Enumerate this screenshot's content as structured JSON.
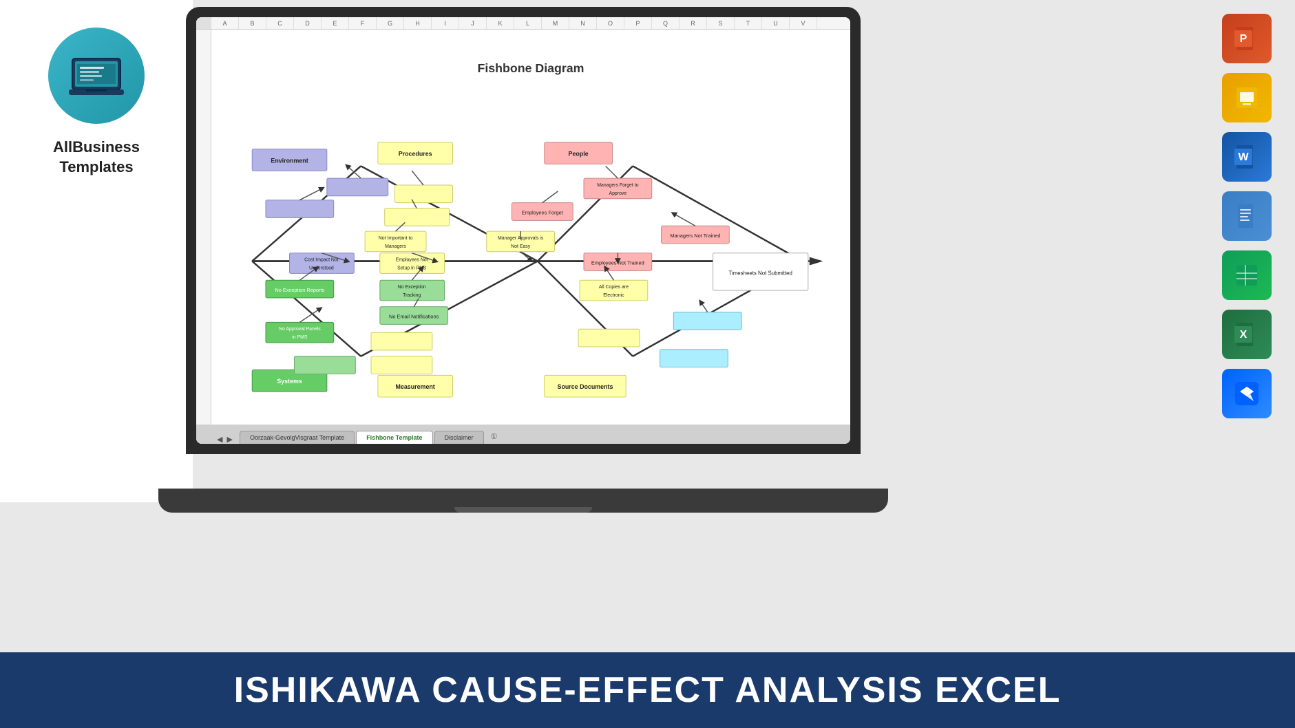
{
  "brand": {
    "name": "AllBusiness\nTemplates",
    "circle_color": "#3bb5c8"
  },
  "diagram": {
    "title": "Fishbone Diagram",
    "categories": {
      "environment": "Environment",
      "procedures": "Procedures",
      "people": "People",
      "systems": "Systems",
      "measurement": "Measurement",
      "source_documents": "Source Documents"
    },
    "boxes": {
      "managers_forget": "Managers Forget to\nApprove",
      "employees_forget": "Employees Forget",
      "managers_not_trained": "Managers Not Trained",
      "manager_approvals": "Manager Approvals is\nNot Easy",
      "employees_not_trained": "Employees Not Trained",
      "not_important": "Not Important to\nManagers",
      "cost_impact": "Cost Impact Not\nUnderstood",
      "employees_not_setup": "Employees Not\nSetup in PMS",
      "no_exception_reports": "No Exception Reports",
      "no_exception_tracking": "No Exception\nTracking",
      "all_copies": "All Copies are\nElectronic",
      "no_email": "No Email Notifications",
      "no_approval_panels": "No Approval Panels\nin PMS",
      "timesheets": "Timesheets Not Submitted"
    }
  },
  "tabs": {
    "tab1": "Oorzaak-GevolgVisgraat Template",
    "tab2": "Fishbone Template",
    "tab3": "Disclaimer"
  },
  "apps": [
    {
      "name": "powerpoint-icon",
      "label": "PowerPoint",
      "color": "#c43e1c"
    },
    {
      "name": "slides-icon",
      "label": "Google Slides",
      "color": "#e8a000"
    },
    {
      "name": "word-icon",
      "label": "Word",
      "color": "#1254a1"
    },
    {
      "name": "docs-icon",
      "label": "Google Docs",
      "color": "#3a7dc4"
    },
    {
      "name": "sheets-icon",
      "label": "Google Sheets",
      "color": "#0f9d58"
    },
    {
      "name": "excel-icon",
      "label": "Excel",
      "color": "#1e6e3d"
    },
    {
      "name": "dropbox-icon",
      "label": "Dropbox",
      "color": "#0061fe"
    }
  ],
  "banner": {
    "text": "ISHIKAWA CAUSE-EFFECT ANALYSIS  EXCEL"
  }
}
